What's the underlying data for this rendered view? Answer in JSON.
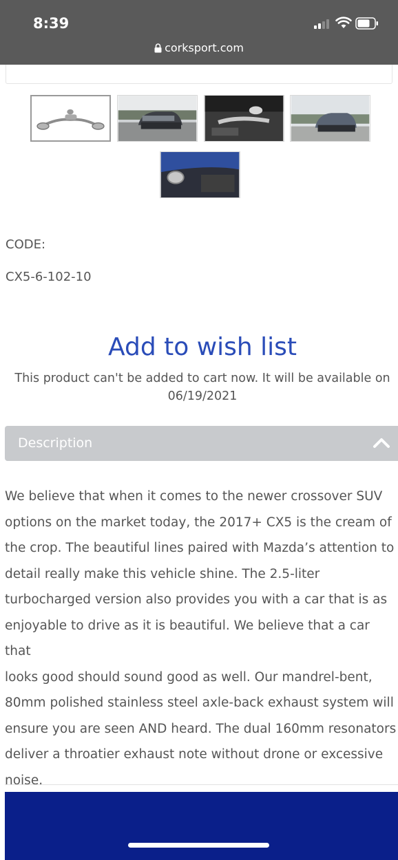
{
  "status_bar": {
    "time": "8:39",
    "url": "corksport.com",
    "icons": [
      "signal-icon",
      "wifi-icon",
      "battery-icon",
      "lock-icon"
    ]
  },
  "gallery": {
    "thumbnails": [
      {
        "name": "exhaust-system-photo",
        "selected": true
      },
      {
        "name": "cx5-rear-road-photo",
        "selected": false
      },
      {
        "name": "exhaust-installed-underside-photo",
        "selected": false
      },
      {
        "name": "cx5-rear-field-photo",
        "selected": false
      },
      {
        "name": "exhaust-tip-closeup-photo",
        "selected": false
      }
    ]
  },
  "product": {
    "code_label": "CODE:",
    "code_value": "CX5-6-102-10",
    "wishlist_label": "Add to wish list",
    "availability_line1": "This product can't be added to cart now. It will be available on",
    "availability_line2": "06/19/2021"
  },
  "description": {
    "header": "Description",
    "lines": [
      "We believe that when it comes to the newer crossover SUV",
      "options on the market today, the 2017+ CX5 is the cream of",
      "the crop. The beautiful lines paired with Mazda’s attention to",
      "detail really make this vehicle shine. The 2.5-liter",
      "turbocharged version also provides you with a car that is as",
      "enjoyable to drive as it is beautiful. We believe that a car that",
      "looks good should sound good as well. Our mandrel-bent,",
      "80mm polished stainless steel axle-back exhaust system will",
      "ensure you are seen AND heard. The dual 160mm resonators",
      "deliver a throatier exhaust note without drone or excessive",
      "noise."
    ]
  },
  "colors": {
    "status_bar": "#5a5a5a",
    "link": "#2a4cb8",
    "accordion": "#c8cacd",
    "footer": "#0a1f8a"
  }
}
